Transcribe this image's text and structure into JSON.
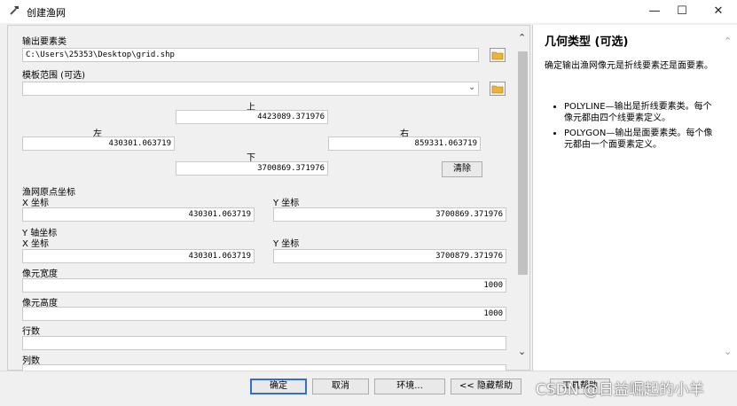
{
  "window": {
    "title": "创建渔网",
    "minimize": "—",
    "maximize": "☐",
    "close": "✕"
  },
  "form": {
    "output_features": {
      "label": "输出要素类",
      "value": "C:\\Users\\25353\\Desktop\\grid.shp"
    },
    "template_extent": {
      "label": "模板范围 (可选)",
      "value": ""
    },
    "extent": {
      "top_label": "上",
      "top": "4423089.371976",
      "left_label": "左",
      "left": "430301.063719",
      "right_label": "右",
      "right": "859331.063719",
      "bottom_label": "下",
      "bottom": "3700869.371976",
      "clear_button": "清除"
    },
    "origin": {
      "label": "渔网原点坐标",
      "x_label": "X 坐标",
      "x": "430301.063719",
      "y_label": "Y 坐标",
      "y": "3700869.371976"
    },
    "y_axis": {
      "label": "Y 轴坐标",
      "x_label": "X 坐标",
      "x": "430301.063719",
      "y_label": "Y 坐标",
      "y": "3700879.371976"
    },
    "cell_width": {
      "label": "像元宽度",
      "value": "1000"
    },
    "cell_height": {
      "label": "像元高度",
      "value": "1000"
    },
    "rows": {
      "label": "行数",
      "value": ""
    },
    "columns": {
      "label": "列数",
      "value": ""
    }
  },
  "help": {
    "title": "几何类型 (可选)",
    "intro": "确定输出渔网像元是折线要素还是面要素。",
    "items": [
      "POLYLINE—输出是折线要素类。每个像元都由四个线要素定义。",
      "POLYGON—输出是面要素类。每个像元都由一个面要素定义。"
    ]
  },
  "buttons": {
    "ok": "确定",
    "cancel": "取消",
    "environments": "环境...",
    "hide_help": "<< 隐藏帮助",
    "tool_help": "工具帮助"
  },
  "watermark": "CSDN @日益崛起的小羊",
  "colors": {
    "folder": "#e8b53a",
    "primary_border": "#2f6fd6"
  }
}
